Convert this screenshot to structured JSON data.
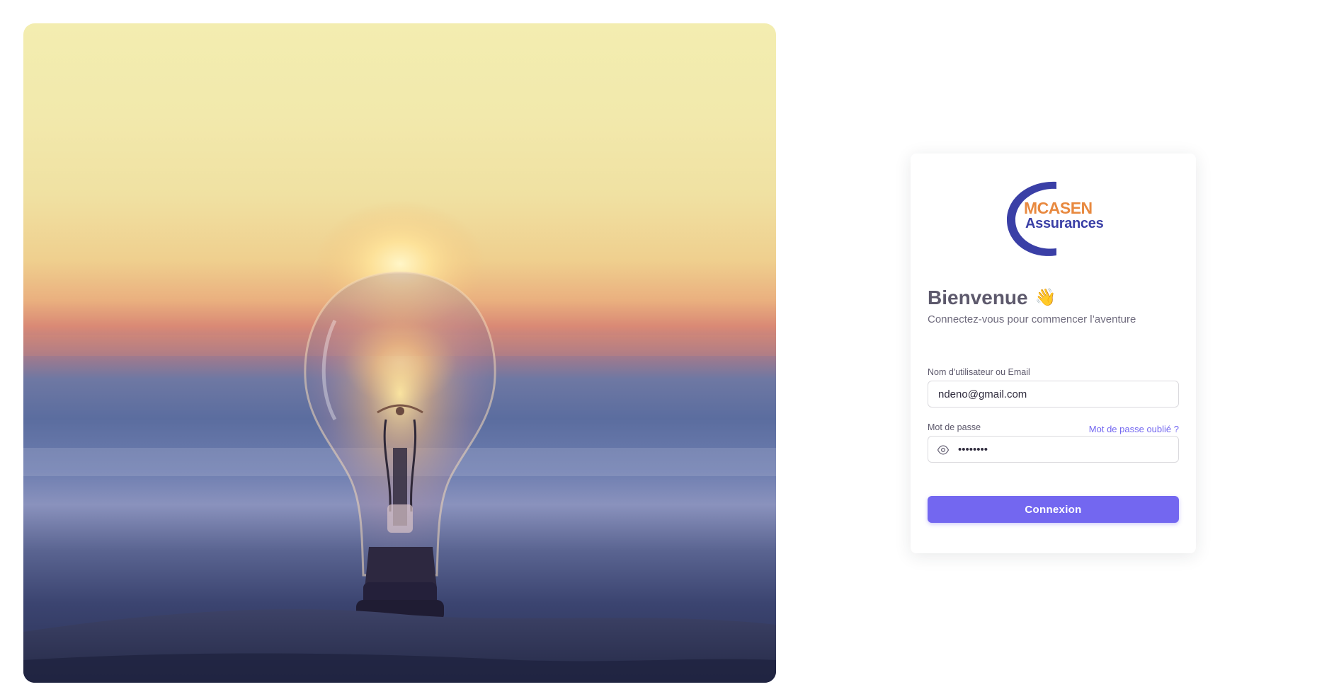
{
  "hero": {
    "image_icon": "lightbulb-sunset-photo",
    "description_icon": "lightbulb-icon"
  },
  "logo": {
    "brand": "MCASEN",
    "sub": "Assurances",
    "icon": "crescent-c-logo-icon",
    "colors": {
      "brand": "#e8893f",
      "sub": "#3a3fa6"
    }
  },
  "login": {
    "title": "Bienvenue",
    "title_emoji": "👋",
    "subtitle": "Connectez-vous pour commencer l’aventure",
    "username_label": "Nom d'utilisateur ou Email",
    "username_value": "ndeno@gmail.com",
    "password_label": "Mot de passe",
    "password_value": "********",
    "forgot_label": "Mot de passe oublié ?",
    "submit_label": "Connexion",
    "eye_icon": "eye-icon"
  },
  "theme": {
    "primary": "#7367f0",
    "text": "#5d596c",
    "border": "#dbdade"
  }
}
